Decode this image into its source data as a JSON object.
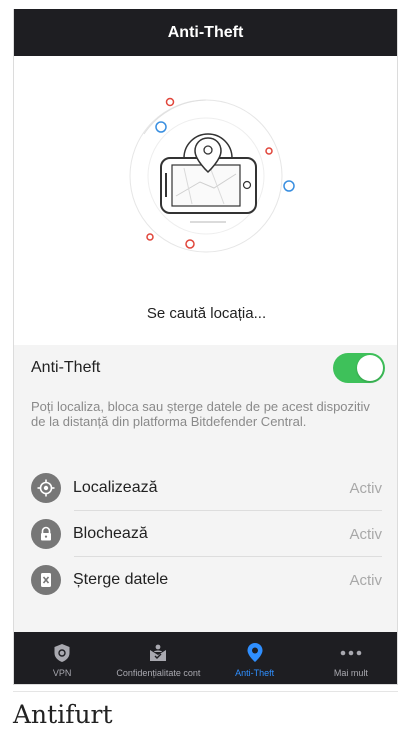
{
  "header": {
    "title": "Anti-Theft"
  },
  "hero": {
    "status_text": "Se caută locația..."
  },
  "anti_theft": {
    "title": "Anti-Theft",
    "toggle_on": true,
    "description": "Poți localiza, bloca sau șterge datele de pe acest dispozitiv de la distanță din platforma Bitdefender Central."
  },
  "features": [
    {
      "name": "Localizează",
      "status": "Activ",
      "icon": "crosshair-icon"
    },
    {
      "name": "Blochează",
      "status": "Activ",
      "icon": "lock-icon"
    },
    {
      "name": "Șterge datele",
      "status": "Activ",
      "icon": "wipe-icon"
    }
  ],
  "nav": [
    {
      "label": "VPN",
      "icon": "shield-icon",
      "active": false
    },
    {
      "label": "Confidențialitate cont",
      "icon": "account-privacy-icon",
      "active": false
    },
    {
      "label": "Anti-Theft",
      "icon": "location-pin-icon",
      "active": true
    },
    {
      "label": "Mai mult",
      "icon": "more-dots-icon",
      "active": false
    }
  ],
  "caption": "Antifurt",
  "colors": {
    "header_bg": "#1e1e22",
    "toggle_green": "#3ec15a",
    "active_blue": "#2f8fff",
    "dot_red": "#e0453a",
    "dot_blue": "#3a8fe0"
  }
}
